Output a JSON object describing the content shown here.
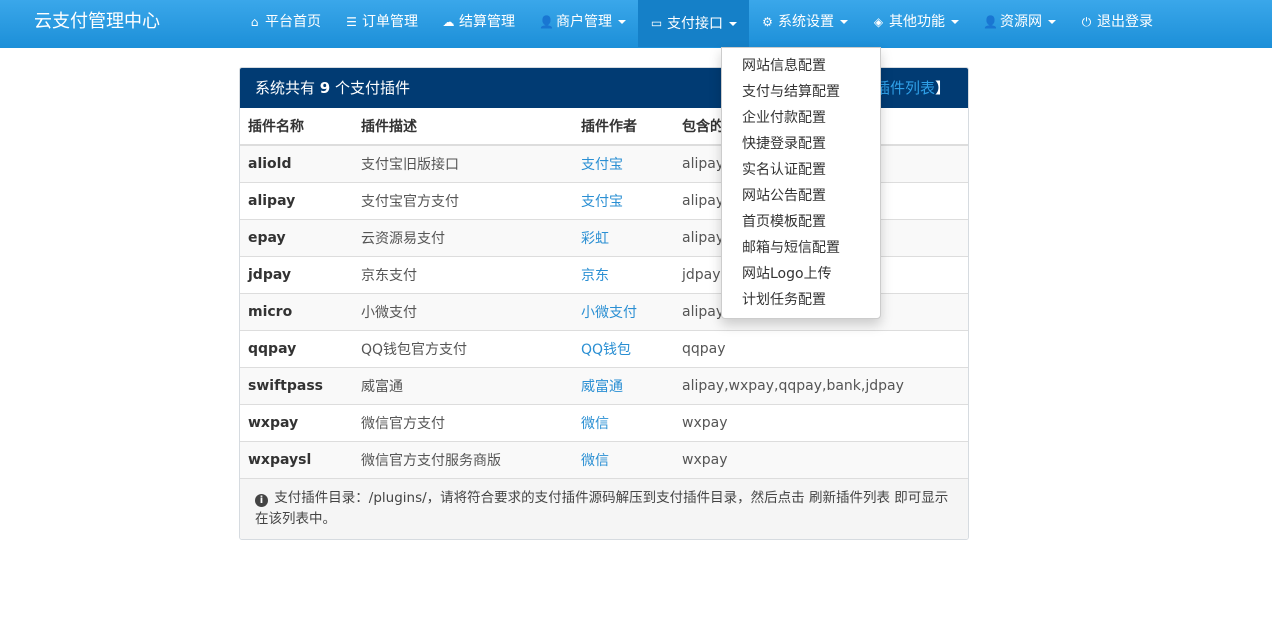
{
  "navbar": {
    "brand": "云支付管理中心",
    "items": [
      {
        "label": "平台首页",
        "icon": "home-icon",
        "glyph": "⌂",
        "caret": false
      },
      {
        "label": "订单管理",
        "icon": "list-icon",
        "glyph": "☰",
        "caret": false
      },
      {
        "label": "结算管理",
        "icon": "cloud-icon",
        "glyph": "☁",
        "caret": false
      },
      {
        "label": "商户管理",
        "icon": "user-icon",
        "glyph": "👤",
        "caret": true
      },
      {
        "label": "支付接口",
        "icon": "credit-card-icon",
        "glyph": "▭",
        "caret": true
      },
      {
        "label": "系统设置",
        "icon": "gear-icon",
        "glyph": "⚙",
        "caret": true
      },
      {
        "label": "其他功能",
        "icon": "cube-icon",
        "glyph": "◈",
        "caret": true
      },
      {
        "label": "资源网",
        "icon": "user-icon",
        "glyph": "👤",
        "caret": true
      },
      {
        "label": "退出登录",
        "icon": "power-icon",
        "glyph": "⏻",
        "caret": false
      }
    ]
  },
  "panel": {
    "heading_prefix": "系统共有 ",
    "count": "9",
    "heading_suffix": " 个支付插件",
    "link_text": "插件列表",
    "link_bracket": "】",
    "columns": [
      "插件名称",
      "插件描述",
      "插件作者",
      "包含的"
    ],
    "rows": [
      {
        "name": "aliold",
        "desc": "支付宝旧版接口",
        "author": "支付宝",
        "types": "alipay"
      },
      {
        "name": "alipay",
        "desc": "支付宝官方支付",
        "author": "支付宝",
        "types": "alipay"
      },
      {
        "name": "epay",
        "desc": "云资源易支付",
        "author": "彩虹",
        "types": "alipay,"
      },
      {
        "name": "jdpay",
        "desc": "京东支付",
        "author": "京东",
        "types": "jdpay"
      },
      {
        "name": "micro",
        "desc": "小微支付",
        "author": "小微支付",
        "types": "alipay,"
      },
      {
        "name": "qqpay",
        "desc": "QQ钱包官方支付",
        "author": "QQ钱包",
        "types": "qqpay"
      },
      {
        "name": "swiftpass",
        "desc": "威富通",
        "author": "威富通",
        "types": "alipay,wxpay,qqpay,bank,jdpay"
      },
      {
        "name": "wxpay",
        "desc": "微信官方支付",
        "author": "微信",
        "types": "wxpay"
      },
      {
        "name": "wxpaysl",
        "desc": "微信官方支付服务商版",
        "author": "微信",
        "types": "wxpay"
      }
    ],
    "footer_note": "支付插件目录：/plugins/，请将符合要求的支付插件源码解压到支付插件目录，然后点击 刷新插件列表 即可显示在该列表中。"
  },
  "dropdown": {
    "items": [
      "网站信息配置",
      "支付与结算配置",
      "企业付款配置",
      "快捷登录配置",
      "实名认证配置",
      "网站公告配置",
      "首页模板配置",
      "邮箱与短信配置",
      "网站Logo上传",
      "计划任务配置"
    ]
  },
  "colors": {
    "navbar": "#1c8fd8",
    "panel_heading": "#013b73",
    "link": "#2a8fd3"
  }
}
